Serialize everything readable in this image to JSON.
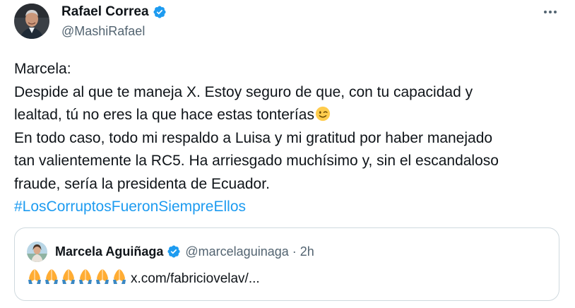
{
  "author": {
    "name": "Rafael Correa",
    "handle": "@MashiRafael"
  },
  "tweet": {
    "lines": [
      "Marcela:",
      "Despide al que te maneja X. Estoy seguro de que, con tu capacidad y",
      "lealtad, tú no eres la que hace estas tonterías",
      "En todo caso, todo mi respaldo a Luisa y mi gratitud por haber manejado",
      "tan valientemente la RC5. Ha arriesgado muchísimo y, sin el escandaloso",
      "fraude, sería la presidenta de Ecuador."
    ],
    "hashtag": "#LosCorruptosFueronSiempreEllos",
    "emoji": "winking-face-icon"
  },
  "quote": {
    "name": "Marcela Aguiñaga",
    "handle": "@marcelaguinaga",
    "separator": "·",
    "time": "2h",
    "emoji_count": 6,
    "link": "x.com/fabriciovelav/..."
  },
  "icons": {
    "verified": "verified-badge-icon",
    "more": "more-options-icon",
    "pray": "folded-hands-icon"
  },
  "colors": {
    "link": "#1d9bf0",
    "verified": "#1d9bf0",
    "text": "#0f1419",
    "secondary": "#536471",
    "border": "#cfd9de"
  }
}
